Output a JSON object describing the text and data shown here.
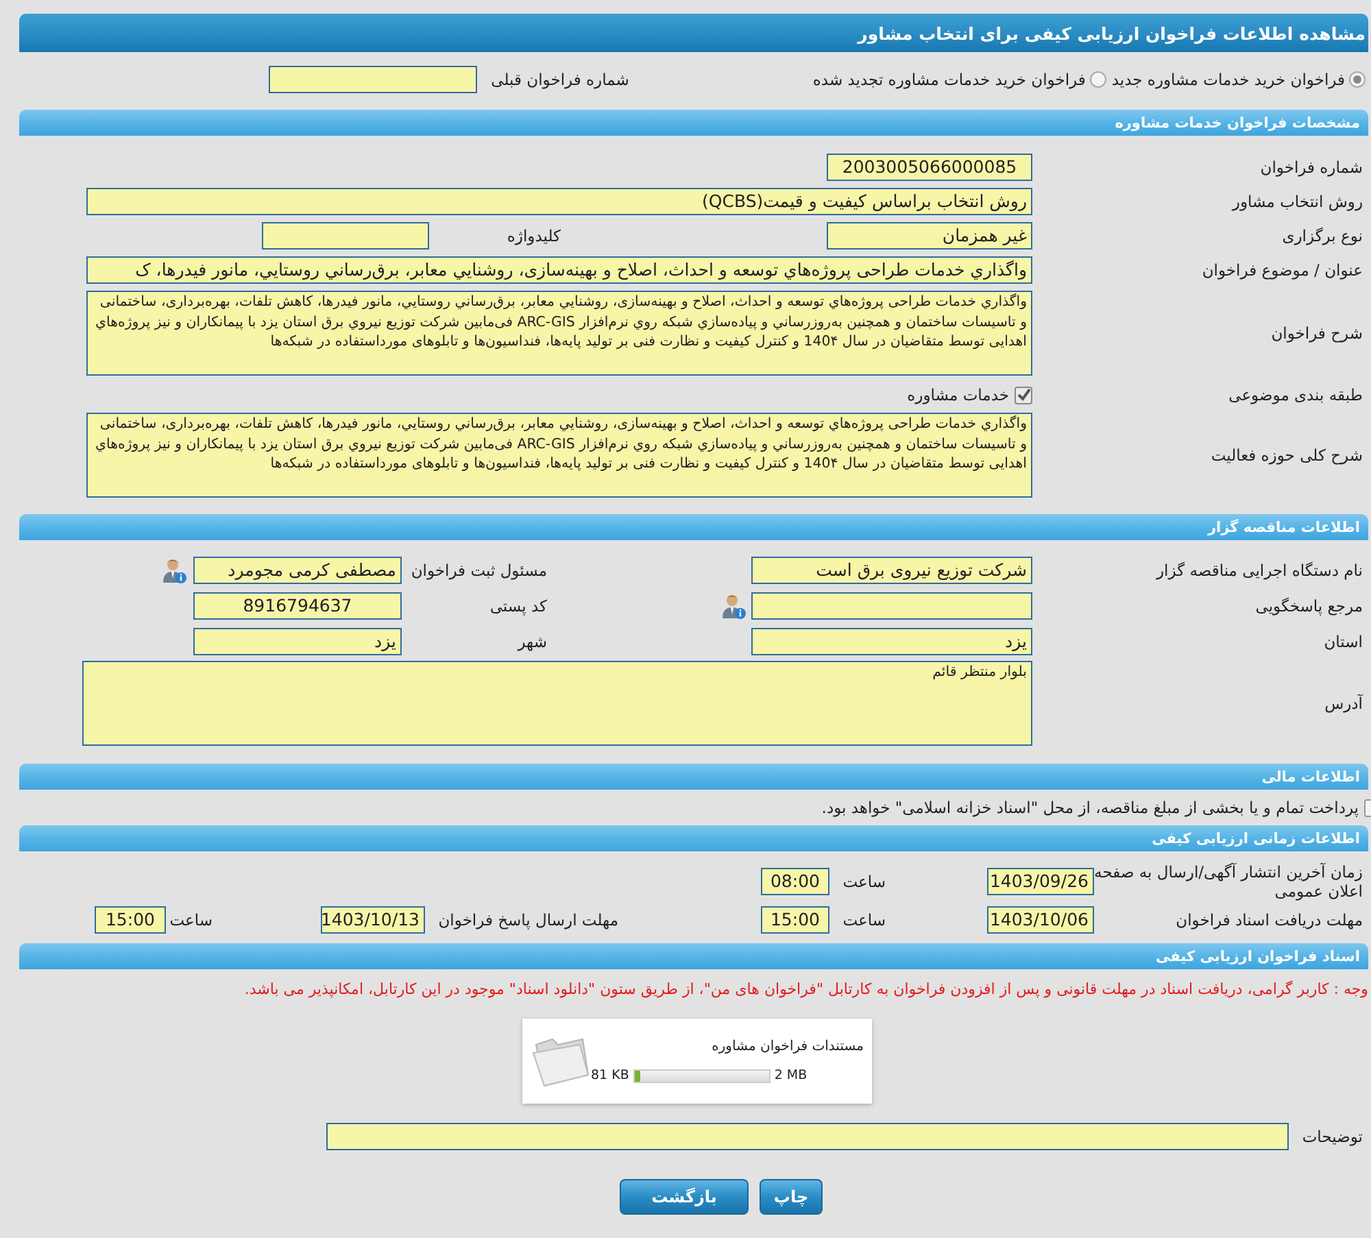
{
  "window": {
    "title": "مشاهده اطلاعات فراخوان ارزیابی کیفی برای انتخاب مشاور"
  },
  "call_type": {
    "options": [
      {
        "label": "فراخوان خرید خدمات مشاوره جدید",
        "selected": true
      },
      {
        "label": "فراخوان خرید خدمات مشاوره تجدید شده",
        "selected": false
      }
    ],
    "previous_number": {
      "label": "شماره فراخوان قبلی"
    }
  },
  "consulting": {
    "title": "مشخصات فراخوان خدمات مشاوره",
    "number": {
      "label": "شماره فراخوان",
      "value": "2003005066000085"
    },
    "method": {
      "label": "روش انتخاب مشاور",
      "value": "روش انتخاب براساس کیفیت و قیمت(QCBS)"
    },
    "holding_type": {
      "label": "نوع برگزاری",
      "value": "غیر همزمان"
    },
    "keyword": {
      "label": "کلیدواژه"
    },
    "subject": {
      "label": "عنوان / موضوع فراخوان",
      "value": "واگذاري خدمات طراحی پروژه‌هاي توسعه و احداث، اصلاح و بهینه‌سازی، روشنایي معابر، برق‌رساني روستايي، مانور فیدرها، ک"
    },
    "description": {
      "label": "شرح فراخوان",
      "value": "واگذاري خدمات طراحی پروژه‌هاي توسعه و احداث، اصلاح و بهینه‌سازی، روشنایي معابر، برق‌رساني روستايي، مانور فیدرها، کاهش تلفات، بهره‌برداری، ساختمانی و تاسیسات ساختمان و همچنین به‌روزرساني و پیاده‌سازي شبکه روي نرم‌افزار ARC-GIS فی‌مابین شرکت توزیع نیروي برق استان یزد با پیمانکاران و نیز پروژه‌هاي اهدایی توسط متقاضیان در سال 140۴ و کنترل کیفیت و نظارت فنی بر تولید پایه‌ها، فنداسیون‌ها و تابلوهای مورداستفاده در شبکه‌ها"
    },
    "category": {
      "label": "طبقه بندی موضوعی",
      "option": {
        "label": "خدمات مشاوره",
        "checked": true
      }
    },
    "activity_scope": {
      "label": "شرح کلی حوزه فعالیت",
      "value": "واگذاري خدمات طراحی پروژه‌هاي توسعه و احداث، اصلاح و بهینه‌سازی، روشنایي معابر، برق‌رساني روستايي، مانور فیدرها، کاهش تلفات، بهره‌برداری، ساختمانی و تاسیسات ساختمان و همچنین به‌روزرساني و پیاده‌سازي شبکه روي نرم‌افزار ARC-GIS فی‌مابین شرکت توزیع نیروي برق استان یزد با پیمانکاران و نیز پروژه‌هاي اهدایی توسط متقاضیان در سال 140۴ و کنترل کیفیت و نظارت فنی بر تولید پایه‌ها، فنداسیون‌ها و تابلوهای مورداستفاده در شبکه‌ها"
    }
  },
  "tenderer": {
    "title": "اطلاعات مناقصه گزار",
    "organization": {
      "label": "نام دستگاه اجرایی مناقصه گزار",
      "value": "شرکت توزیع نیروی برق است"
    },
    "registrar": {
      "label": "مسئول ثبت فراخوان",
      "value": "مصطفی  کرمی مجومرد"
    },
    "contact": {
      "label": "مرجع پاسخگویی"
    },
    "postal_code": {
      "label": "کد پستی",
      "value": "8916794637"
    },
    "province": {
      "label": "استان",
      "value": "یزد"
    },
    "city": {
      "label": "شهر",
      "value": "یزد"
    },
    "address": {
      "label": "آدرس",
      "value": "بلوار منتظر قائم"
    }
  },
  "financial": {
    "title": "اطلاعات مالی",
    "treasury_payment": {
      "label": "پرداخت تمام و یا بخشی از مبلغ مناقصه، از محل \"اسناد خزانه اسلامی\" خواهد بود.",
      "checked": false
    }
  },
  "schedule": {
    "title": "اطلاعات زمانی ارزیابی کیفی",
    "publish": {
      "label": "زمان آخرین انتشار آگهی/ارسال به صفحه اعلان عمومی",
      "date": "1403/09/26",
      "time_label": "ساعت",
      "time": "08:00"
    },
    "receive": {
      "label": "مهلت دریافت اسناد فراخوان",
      "date": "1403/10/06",
      "time_label": "ساعت",
      "time": "15:00"
    },
    "response": {
      "label": "مهلت ارسال پاسخ فراخوان",
      "date": "1403/10/13",
      "time_label": "ساعت",
      "time": "15:00"
    }
  },
  "documents": {
    "title": "اسناد فراخوان ارزیابی کیفی",
    "notice": "وجه : کاربر گرامی، دریافت اسناد در مهلت قانونی و پس از افزودن فراخوان به کارتابل \"فراخوان های من\"، از طریق ستون \"دانلود اسناد\" موجود در این کارتابل، امکانپذیر می باشد.",
    "file": {
      "name": "مستندات فراخوان مشاوره",
      "size": "81 KB",
      "max": "2 MB",
      "level": 0.04
    },
    "notes": {
      "label": "توضیحات"
    }
  },
  "buttons": [
    {
      "label": "چاپ"
    },
    {
      "label": "بازگشت"
    }
  ]
}
